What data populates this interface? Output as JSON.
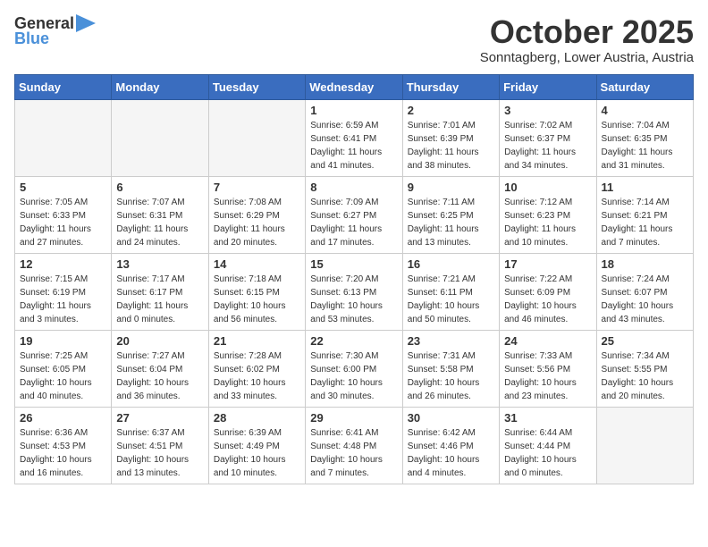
{
  "logo": {
    "general": "General",
    "blue": "Blue"
  },
  "header": {
    "month": "October 2025",
    "location": "Sonntagberg, Lower Austria, Austria"
  },
  "weekdays": [
    "Sunday",
    "Monday",
    "Tuesday",
    "Wednesday",
    "Thursday",
    "Friday",
    "Saturday"
  ],
  "weeks": [
    [
      {
        "day": "",
        "info": ""
      },
      {
        "day": "",
        "info": ""
      },
      {
        "day": "",
        "info": ""
      },
      {
        "day": "1",
        "info": "Sunrise: 6:59 AM\nSunset: 6:41 PM\nDaylight: 11 hours\nand 41 minutes."
      },
      {
        "day": "2",
        "info": "Sunrise: 7:01 AM\nSunset: 6:39 PM\nDaylight: 11 hours\nand 38 minutes."
      },
      {
        "day": "3",
        "info": "Sunrise: 7:02 AM\nSunset: 6:37 PM\nDaylight: 11 hours\nand 34 minutes."
      },
      {
        "day": "4",
        "info": "Sunrise: 7:04 AM\nSunset: 6:35 PM\nDaylight: 11 hours\nand 31 minutes."
      }
    ],
    [
      {
        "day": "5",
        "info": "Sunrise: 7:05 AM\nSunset: 6:33 PM\nDaylight: 11 hours\nand 27 minutes."
      },
      {
        "day": "6",
        "info": "Sunrise: 7:07 AM\nSunset: 6:31 PM\nDaylight: 11 hours\nand 24 minutes."
      },
      {
        "day": "7",
        "info": "Sunrise: 7:08 AM\nSunset: 6:29 PM\nDaylight: 11 hours\nand 20 minutes."
      },
      {
        "day": "8",
        "info": "Sunrise: 7:09 AM\nSunset: 6:27 PM\nDaylight: 11 hours\nand 17 minutes."
      },
      {
        "day": "9",
        "info": "Sunrise: 7:11 AM\nSunset: 6:25 PM\nDaylight: 11 hours\nand 13 minutes."
      },
      {
        "day": "10",
        "info": "Sunrise: 7:12 AM\nSunset: 6:23 PM\nDaylight: 11 hours\nand 10 minutes."
      },
      {
        "day": "11",
        "info": "Sunrise: 7:14 AM\nSunset: 6:21 PM\nDaylight: 11 hours\nand 7 minutes."
      }
    ],
    [
      {
        "day": "12",
        "info": "Sunrise: 7:15 AM\nSunset: 6:19 PM\nDaylight: 11 hours\nand 3 minutes."
      },
      {
        "day": "13",
        "info": "Sunrise: 7:17 AM\nSunset: 6:17 PM\nDaylight: 11 hours\nand 0 minutes."
      },
      {
        "day": "14",
        "info": "Sunrise: 7:18 AM\nSunset: 6:15 PM\nDaylight: 10 hours\nand 56 minutes."
      },
      {
        "day": "15",
        "info": "Sunrise: 7:20 AM\nSunset: 6:13 PM\nDaylight: 10 hours\nand 53 minutes."
      },
      {
        "day": "16",
        "info": "Sunrise: 7:21 AM\nSunset: 6:11 PM\nDaylight: 10 hours\nand 50 minutes."
      },
      {
        "day": "17",
        "info": "Sunrise: 7:22 AM\nSunset: 6:09 PM\nDaylight: 10 hours\nand 46 minutes."
      },
      {
        "day": "18",
        "info": "Sunrise: 7:24 AM\nSunset: 6:07 PM\nDaylight: 10 hours\nand 43 minutes."
      }
    ],
    [
      {
        "day": "19",
        "info": "Sunrise: 7:25 AM\nSunset: 6:05 PM\nDaylight: 10 hours\nand 40 minutes."
      },
      {
        "day": "20",
        "info": "Sunrise: 7:27 AM\nSunset: 6:04 PM\nDaylight: 10 hours\nand 36 minutes."
      },
      {
        "day": "21",
        "info": "Sunrise: 7:28 AM\nSunset: 6:02 PM\nDaylight: 10 hours\nand 33 minutes."
      },
      {
        "day": "22",
        "info": "Sunrise: 7:30 AM\nSunset: 6:00 PM\nDaylight: 10 hours\nand 30 minutes."
      },
      {
        "day": "23",
        "info": "Sunrise: 7:31 AM\nSunset: 5:58 PM\nDaylight: 10 hours\nand 26 minutes."
      },
      {
        "day": "24",
        "info": "Sunrise: 7:33 AM\nSunset: 5:56 PM\nDaylight: 10 hours\nand 23 minutes."
      },
      {
        "day": "25",
        "info": "Sunrise: 7:34 AM\nSunset: 5:55 PM\nDaylight: 10 hours\nand 20 minutes."
      }
    ],
    [
      {
        "day": "26",
        "info": "Sunrise: 6:36 AM\nSunset: 4:53 PM\nDaylight: 10 hours\nand 16 minutes."
      },
      {
        "day": "27",
        "info": "Sunrise: 6:37 AM\nSunset: 4:51 PM\nDaylight: 10 hours\nand 13 minutes."
      },
      {
        "day": "28",
        "info": "Sunrise: 6:39 AM\nSunset: 4:49 PM\nDaylight: 10 hours\nand 10 minutes."
      },
      {
        "day": "29",
        "info": "Sunrise: 6:41 AM\nSunset: 4:48 PM\nDaylight: 10 hours\nand 7 minutes."
      },
      {
        "day": "30",
        "info": "Sunrise: 6:42 AM\nSunset: 4:46 PM\nDaylight: 10 hours\nand 4 minutes."
      },
      {
        "day": "31",
        "info": "Sunrise: 6:44 AM\nSunset: 4:44 PM\nDaylight: 10 hours\nand 0 minutes."
      },
      {
        "day": "",
        "info": ""
      }
    ]
  ]
}
